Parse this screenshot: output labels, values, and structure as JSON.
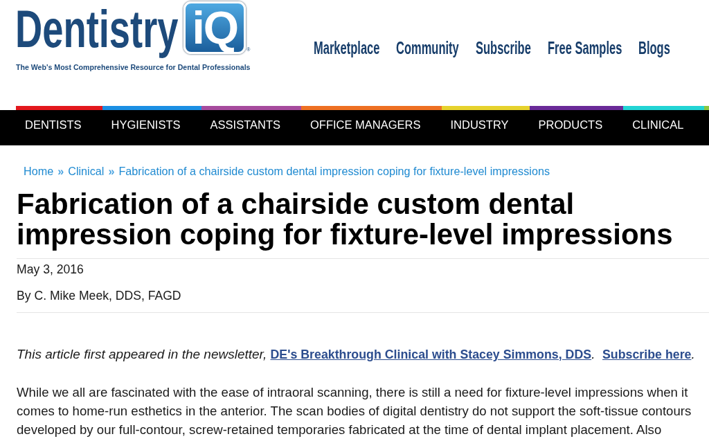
{
  "header": {
    "logo": {
      "wordmark": "Dentistry",
      "badge": "iQ",
      "registered_mark": "®",
      "tagline": "The Web's Most Comprehensive Resource for Dental Professionals"
    },
    "links": [
      "Marketplace",
      "Community",
      "Subscribe",
      "Free Samples",
      "Blogs"
    ]
  },
  "main_nav": {
    "items": [
      {
        "label": "DENTISTS",
        "color": "#e3171c"
      },
      {
        "label": "HYGIENISTS",
        "color": "#1b8fe3"
      },
      {
        "label": "ASSISTANTS",
        "color": "#a64b9d"
      },
      {
        "label": "OFFICE MANAGERS",
        "color": "#ee7022"
      },
      {
        "label": "INDUSTRY",
        "color": "#e6d22c"
      },
      {
        "label": "PRODUCTS",
        "color": "#6a2a98"
      },
      {
        "label": "CLINICAL",
        "color": "#22d4d4"
      }
    ],
    "cut_item": {
      "color": "#8cc63f"
    }
  },
  "breadcrumb": [
    {
      "kind": "link",
      "text": "Home"
    },
    {
      "kind": "separator",
      "text": "»"
    },
    {
      "kind": "link",
      "text": "Clinical"
    },
    {
      "kind": "separator",
      "text": "»"
    },
    {
      "kind": "link",
      "text": "Fabrication of a chairside custom dental impression coping for fixture-level impressions"
    }
  ],
  "article": {
    "title": "Fabrication of a chairside custom dental impression coping for fixture-level impressions",
    "date": "May 3, 2016",
    "byline": "By C. Mike Meek, DDS, FAGD",
    "intro": [
      {
        "kind": "text",
        "text": "This article first appeared in the newsletter, "
      },
      {
        "kind": "link",
        "text": "DE's Breakthrough Clinical with Stacey Simmons, DDS"
      },
      {
        "kind": "text",
        "text": ".  "
      },
      {
        "kind": "link",
        "text": "Subscribe here"
      },
      {
        "kind": "text",
        "text": "."
      }
    ],
    "body_lines": [
      "While we all are fascinated with the ease of intraoral scanning, there is still a need for fixture-level impressions when it",
      "comes to home-run esthetics in the anterior. The scan bodies of digital dentistry do not support the soft-tissue contours",
      "developed by our full-contour, screw-retained temporaries fabricated at the time of dental implant placement. Also"
    ]
  }
}
